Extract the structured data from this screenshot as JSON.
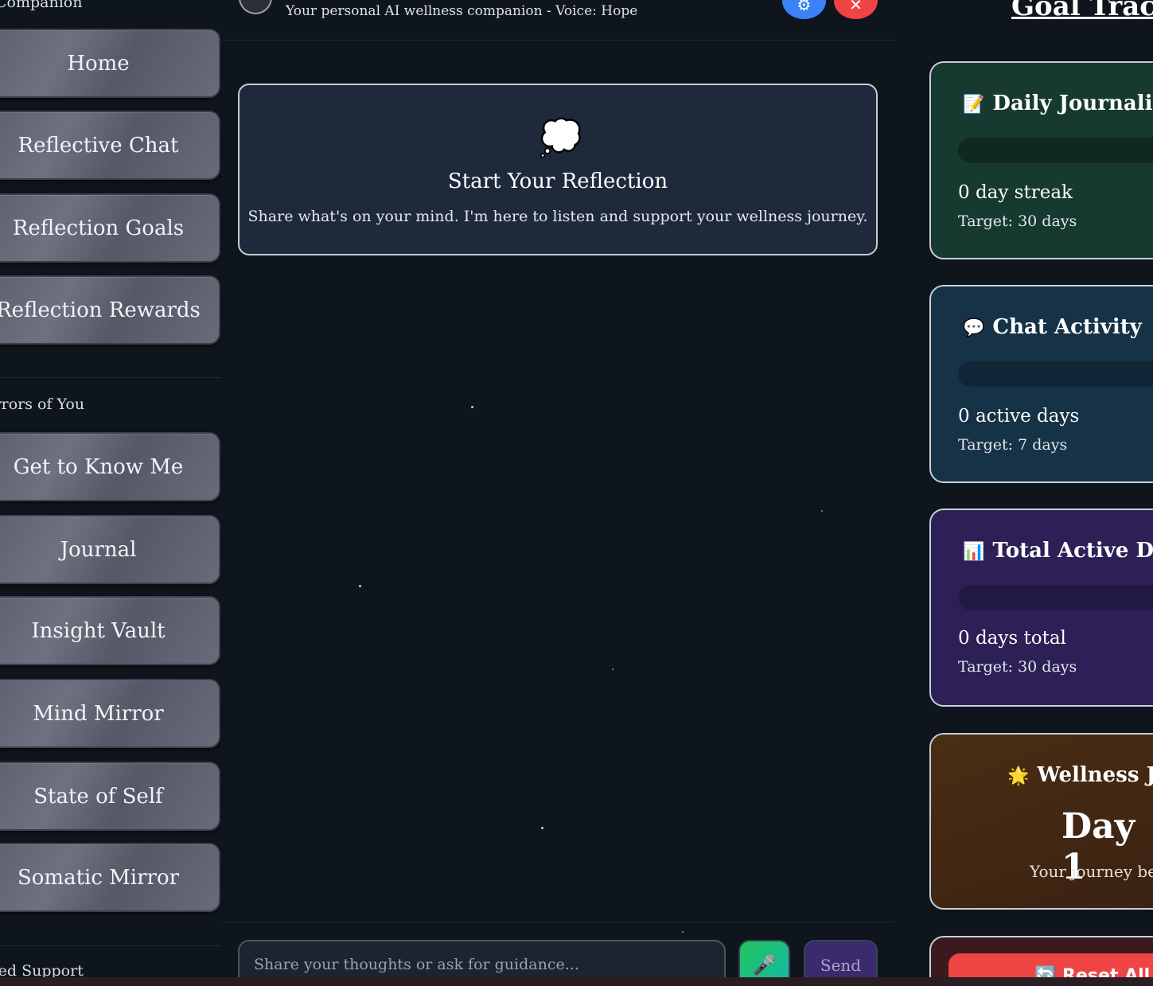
{
  "sidebar": {
    "top_section_title": "Companion",
    "nav_items": [
      {
        "label": "Home"
      },
      {
        "label": "Reflective Chat"
      },
      {
        "label": "Reflection Goals"
      },
      {
        "label": "Reflection Rewards"
      }
    ],
    "mirrors_section_title": "Mirrors of You",
    "mirror_items": [
      {
        "label": "Get to Know Me"
      },
      {
        "label": "Journal"
      },
      {
        "label": "Insight Vault"
      },
      {
        "label": "Mind Mirror"
      },
      {
        "label": "State of Self"
      },
      {
        "label": "Somatic Mirror"
      }
    ],
    "support_section_title": "Guided Support"
  },
  "header": {
    "subtitle": "Your personal AI wellness companion - Voice: Hope",
    "settings_icon": "gear-icon",
    "close_icon": "close-icon",
    "settings_glyph": "⚙",
    "close_glyph": "✕"
  },
  "reflection": {
    "icon": "💭",
    "title": "Start Your Reflection",
    "text": "Share what's on your mind. I'm here to listen and support your wellness journey."
  },
  "composer": {
    "placeholder": "Share your thoughts or ask for guidance...",
    "mic_glyph": "🎤",
    "send_label": "Send"
  },
  "goal_tracker": {
    "title": "Goal Tracker",
    "cards": [
      {
        "icon": "📝",
        "title": "Daily Journaling",
        "value": "0 day streak",
        "target": "Target: 30 days",
        "progress": 0
      },
      {
        "icon": "💬",
        "title": "Chat Activity",
        "value": "0 active days",
        "target": "Target: 7 days",
        "progress": 0
      },
      {
        "icon": "📊",
        "title": "Total Active Days",
        "value": "0 days total",
        "target": "Target: 30 days",
        "progress": 0
      }
    ],
    "wellness": {
      "icon": "🌟",
      "title": "Wellness Journey",
      "day": "Day 1",
      "text": "Your journey begins today"
    },
    "reset_label": "🔄 Reset All Data"
  },
  "colors": {
    "background": "#0f151d",
    "card_journal": "#163a2f",
    "card_chat": "#163247",
    "card_active": "#2c2056",
    "accent_blue": "#3b82f6",
    "accent_red": "#ef4444"
  }
}
